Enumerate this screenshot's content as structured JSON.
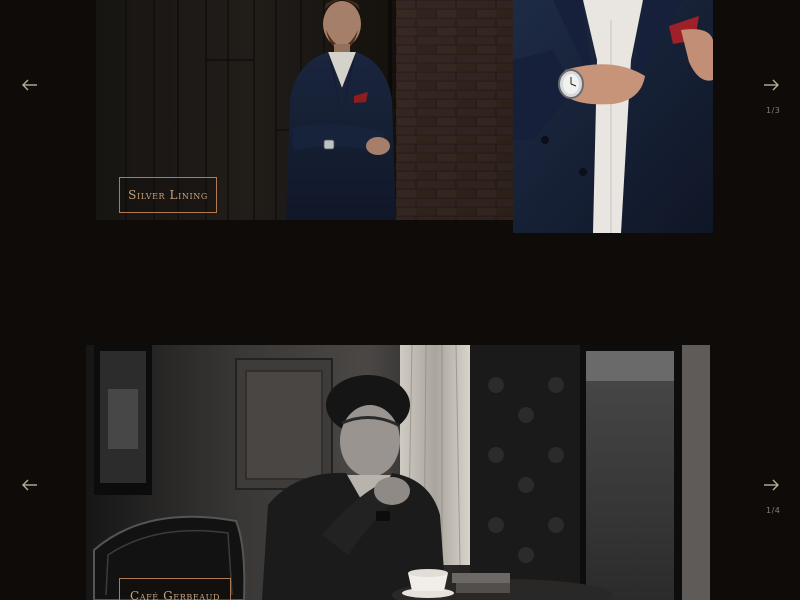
{
  "galleries": [
    {
      "caption": "Silver Lining",
      "counter": "1/3",
      "prev_icon": "arrow-left-icon",
      "next_icon": "arrow-right-icon",
      "photos": [
        "man in navy suit leaning against brick wall",
        "close-up of wristwatch and red pocket square"
      ]
    },
    {
      "caption": "Café Gerbeaud",
      "counter": "1/4",
      "prev_icon": "arrow-left-icon",
      "next_icon": "arrow-right-icon",
      "photos": [
        "black and white photo of man at café table with coffee cup"
      ]
    }
  ],
  "colors": {
    "background": "#0e0b09",
    "caption_border": "#b07a54",
    "caption_text": "#c9a27a",
    "arrow": "#b8ad9c"
  }
}
